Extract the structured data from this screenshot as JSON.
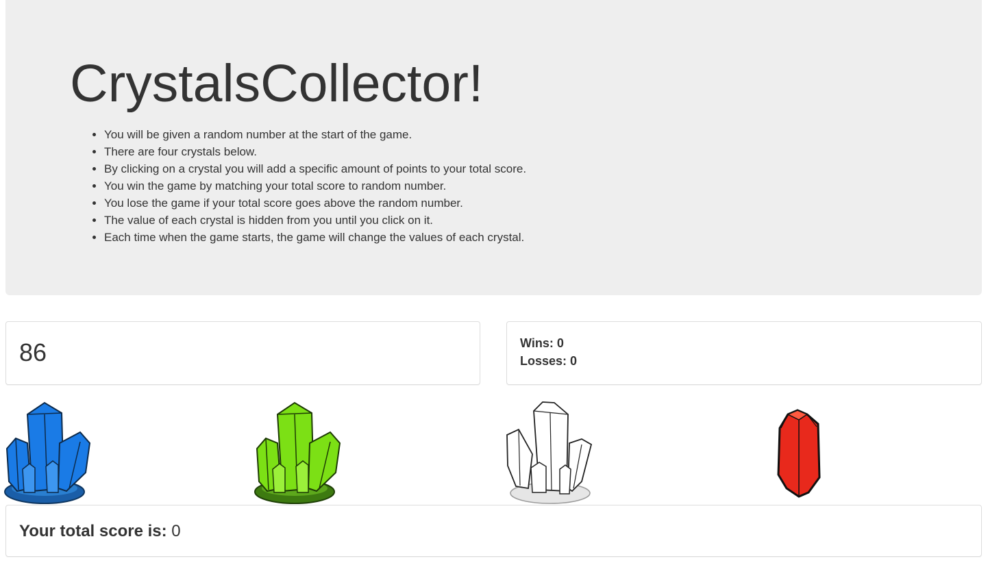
{
  "header": {
    "title": "CrystalsCollector!",
    "rules": [
      "You will be given a random number at the start of the game.",
      "There are four crystals below.",
      "By clicking on a crystal you will add a specific amount of points to your total score.",
      "You win the game by matching your total score to random number.",
      "You lose the game if your total score goes above the random number.",
      "The value of each crystal is hidden from you until you click on it.",
      "Each time when the game starts, the game will change the values of each crystal."
    ]
  },
  "target": {
    "number": "86"
  },
  "stats": {
    "wins_label": "Wins:",
    "wins": "0",
    "losses_label": "Losses:",
    "losses": "0"
  },
  "crystals": [
    {
      "icon": "blue-crystal-cluster-icon",
      "color": "#1a7be6"
    },
    {
      "icon": "green-crystal-cluster-icon",
      "color": "#7ce015"
    },
    {
      "icon": "white-crystal-cluster-icon",
      "color": "#ffffff"
    },
    {
      "icon": "red-crystal-icon",
      "color": "#e8291c"
    }
  ],
  "score": {
    "label": "Your total score is:",
    "value": "0"
  }
}
